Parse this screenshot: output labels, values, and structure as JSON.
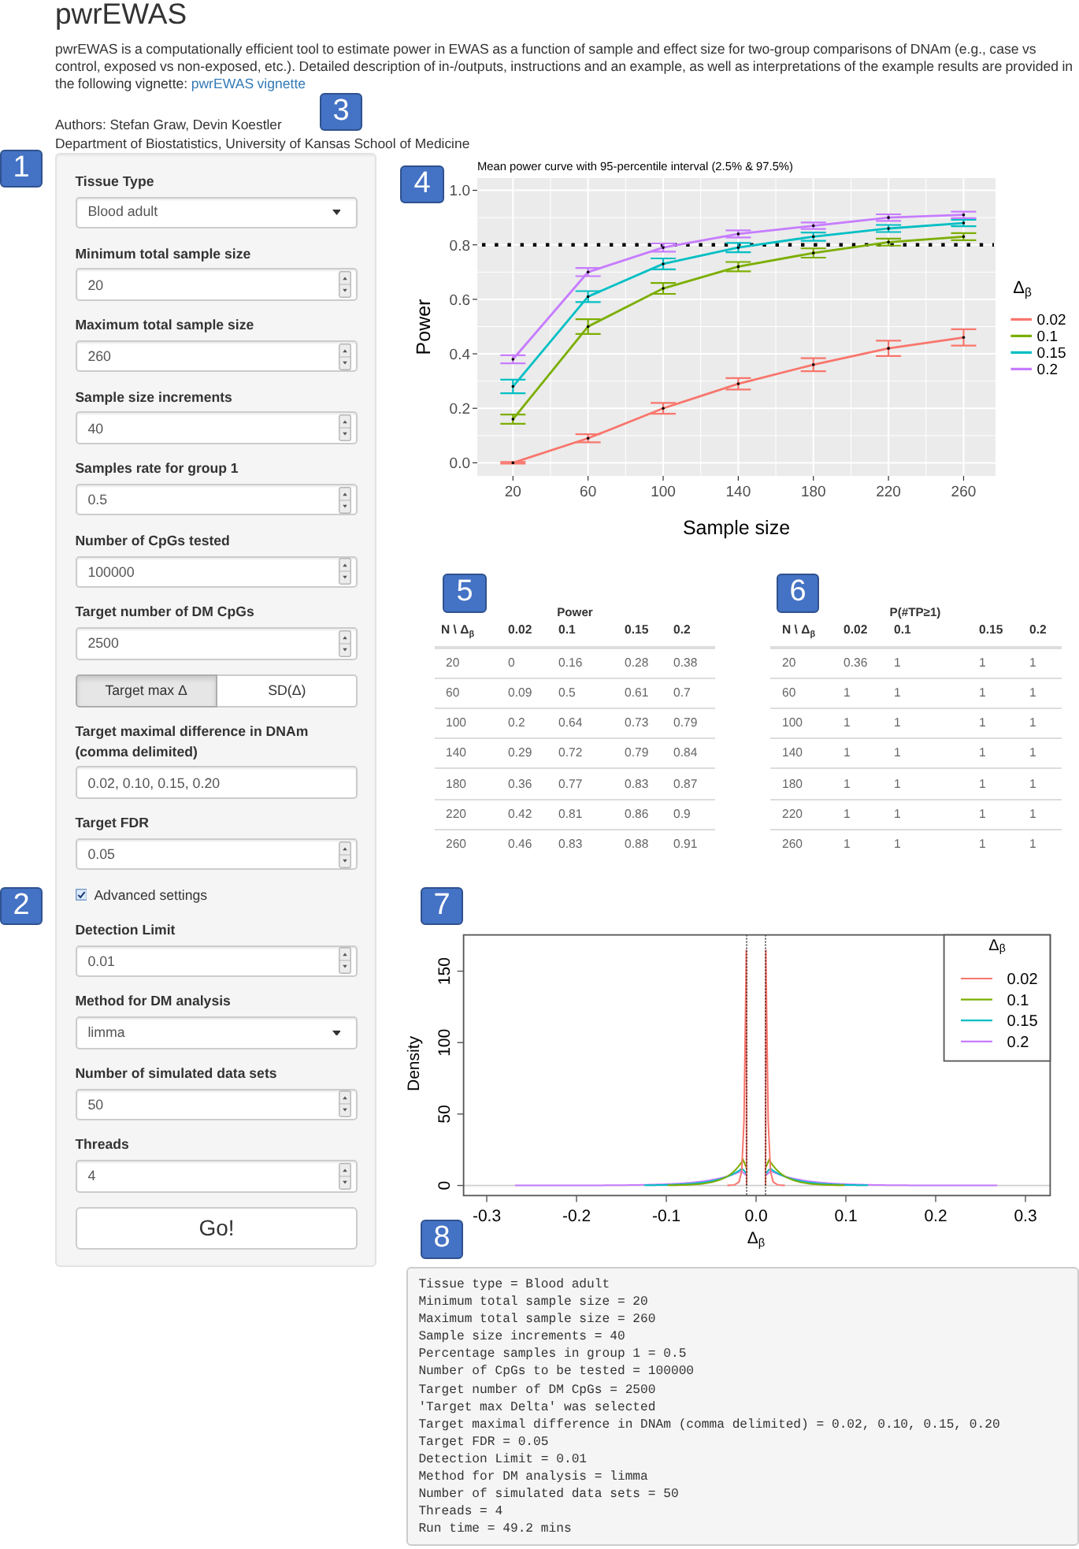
{
  "header": {
    "title": "pwrEWAS",
    "description": "pwrEWAS is a computationally efficient tool to estimate power in EWAS as a function of sample and effect size for two-group comparisons of DNAm (e.g., case vs control, exposed vs non-exposed, etc.). Detailed description of in-/outputs, instructions and an example, as well as interpretations of the example results are provided in the following vignette:",
    "link": "pwrEWAS vignette",
    "callout": "3",
    "authors": "Authors: Stefan Graw, Devin Koestler",
    "affiliation": "Department of Biostatistics, University of Kansas School of Medicine"
  },
  "sidebar": {
    "callout": "1",
    "fields": [
      {
        "kind": "select",
        "label": "Tissue Type",
        "value": "Blood adult"
      },
      {
        "kind": "number",
        "label": "Minimum total sample size",
        "value": "20"
      },
      {
        "kind": "number",
        "label": "Maximum total sample size",
        "value": "260"
      },
      {
        "kind": "number",
        "label": "Sample size increments",
        "value": "40"
      },
      {
        "kind": "number",
        "label": "Samples rate for group 1",
        "value": "0.5"
      },
      {
        "kind": "number",
        "label": "Number of CpGs tested",
        "value": "100000"
      },
      {
        "kind": "number",
        "label": "Target number of DM CpGs",
        "value": "2500"
      },
      {
        "kind": "toggle",
        "options": [
          {
            "label": "Target max Δ",
            "selected": true
          },
          {
            "label": "SD(Δ)",
            "selected": false
          }
        ]
      },
      {
        "kind": "text",
        "label": "Target maximal difference in DNAm (comma delimited)",
        "value": "0.02, 0.10, 0.15, 0.20"
      },
      {
        "kind": "number",
        "label": "Target FDR",
        "value": "0.05"
      },
      {
        "kind": "checkbox",
        "label": "Advanced settings",
        "checked": true,
        "callout": "2"
      },
      {
        "kind": "number",
        "label": "Detection Limit",
        "value": "0.01"
      },
      {
        "kind": "select",
        "label": "Method for DM analysis",
        "value": "limma"
      },
      {
        "kind": "number",
        "label": "Number of simulated data sets",
        "value": "50"
      },
      {
        "kind": "number",
        "label": "Threads",
        "value": "4"
      },
      {
        "kind": "button",
        "label": "Go!"
      }
    ]
  },
  "power_chart": {
    "callout": "4",
    "chart_data": {
      "type": "line",
      "title": "Mean power curve with 95-percentile interval (2.5% & 97.5%)",
      "xlabel": "Sample size",
      "ylabel": "Power",
      "x": [
        20,
        60,
        100,
        140,
        180,
        220,
        260
      ],
      "series": [
        {
          "name": "0.02",
          "color": "#f8766d",
          "values": [
            0,
            0.09,
            0.2,
            0.29,
            0.36,
            0.42,
            0.46
          ],
          "errors": [
            0.003,
            0.015,
            0.02,
            0.021,
            0.024,
            0.028,
            0.03
          ]
        },
        {
          "name": "0.1",
          "color": "#7cae00",
          "values": [
            0.16,
            0.5,
            0.64,
            0.72,
            0.77,
            0.81,
            0.83
          ],
          "errors": [
            0.017,
            0.027,
            0.02,
            0.017,
            0.017,
            0.013,
            0.013
          ]
        },
        {
          "name": "0.15",
          "color": "#00bfc4",
          "values": [
            0.28,
            0.61,
            0.73,
            0.79,
            0.83,
            0.86,
            0.88
          ],
          "errors": [
            0.025,
            0.02,
            0.02,
            0.017,
            0.015,
            0.013,
            0.012
          ]
        },
        {
          "name": "0.2",
          "color": "#c77cff",
          "values": [
            0.38,
            0.7,
            0.79,
            0.84,
            0.87,
            0.9,
            0.91
          ],
          "errors": [
            0.015,
            0.015,
            0.015,
            0.013,
            0.012,
            0.012,
            0.012
          ]
        }
      ],
      "xlim": [
        1,
        277
      ],
      "ylim": [
        -0.048,
        1.045
      ],
      "xticks": [
        20,
        60,
        100,
        140,
        180,
        220,
        260
      ],
      "yticks": [
        {
          "value": 0,
          "label": "0.0"
        },
        {
          "value": 0.2,
          "label": "0.2"
        },
        {
          "value": 0.4,
          "label": "0.4"
        },
        {
          "value": 0.6,
          "label": "0.6"
        },
        {
          "value": 0.8,
          "label": "0.8"
        },
        {
          "value": 1,
          "label": "1.0"
        }
      ],
      "grid": true,
      "legend": {
        "title": "Δ$_{β}$"
      },
      "ref_lines": [
        {
          "axis": "y",
          "value": 0.8
        }
      ]
    }
  },
  "power_table": {
    "callout": "5",
    "caption": "Power",
    "columns": [
      "N \\ Δ$_{β}$",
      "0.02",
      "0.1",
      "0.15",
      "0.2"
    ],
    "rows": [
      [
        "20",
        "0",
        "0.16",
        "0.28",
        "0.38"
      ],
      [
        "60",
        "0.09",
        "0.5",
        "0.61",
        "0.7"
      ],
      [
        "100",
        "0.2",
        "0.64",
        "0.73",
        "0.79"
      ],
      [
        "140",
        "0.29",
        "0.72",
        "0.79",
        "0.84"
      ],
      [
        "180",
        "0.36",
        "0.77",
        "0.83",
        "0.87"
      ],
      [
        "220",
        "0.42",
        "0.81",
        "0.86",
        "0.9"
      ],
      [
        "260",
        "0.46",
        "0.83",
        "0.88",
        "0.91"
      ]
    ]
  },
  "tp_table": {
    "callout": "6",
    "caption": "P(#TP≥1)",
    "columns": [
      "N \\ Δ$_{β}$",
      "0.02",
      "0.1",
      "0.15",
      "0.2"
    ],
    "rows": [
      [
        "20",
        "0.36",
        "1",
        "1",
        "1"
      ],
      [
        "60",
        "1",
        "1",
        "1",
        "1"
      ],
      [
        "100",
        "1",
        "1",
        "1",
        "1"
      ],
      [
        "140",
        "1",
        "1",
        "1",
        "1"
      ],
      [
        "180",
        "1",
        "1",
        "1",
        "1"
      ],
      [
        "220",
        "1",
        "1",
        "1",
        "1"
      ],
      [
        "260",
        "1",
        "1",
        "1",
        "1"
      ]
    ]
  },
  "density_plot": {
    "callout": "7",
    "ylabel": "Density",
    "xlabel": "Δ$_{β}$",
    "yticks": [
      "0",
      "50",
      "100",
      "150"
    ],
    "xticks": [
      "-0.3",
      "-0.2",
      "-0.1",
      "0.0",
      "0.1",
      "0.2",
      "0.3"
    ],
    "legend_title": "Δ$_{β}$",
    "legend": [
      {
        "label": "0.02",
        "color": "#f8766d"
      },
      {
        "label": "0.1",
        "color": "#7cae00"
      },
      {
        "label": "0.15",
        "color": "#00bfc4"
      },
      {
        "label": "0.2",
        "color": "#c77cff"
      }
    ]
  },
  "log": {
    "callout": "8",
    "lines": [
      "Tissue type = Blood adult",
      "Minimum total sample size = 20",
      "Maximum total sample size = 260",
      "Sample size increments = 40",
      "Percentage samples in group 1 = 0.5",
      "Number of CpGs to be tested = 100000",
      "Target number of DM CpGs = 2500",
      "'Target max Delta' was selected",
      "Target maximal difference in DNAm (comma delimited) = 0.02, 0.10, 0.15, 0.20",
      "Target FDR = 0.05",
      "Detection Limit = 0.01",
      "Method for DM analysis = limma",
      "Number of simulated data sets = 50",
      "Threads = 4",
      "Run time = 49.2 mins"
    ]
  }
}
